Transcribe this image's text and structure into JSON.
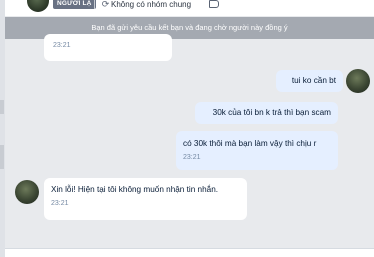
{
  "header": {
    "badge": "NGƯỜI LẠ",
    "group_status": "Không có nhóm chung",
    "group_icon": "refresh-icon",
    "tag_icon": "tag-icon"
  },
  "notice": "Bạn đã gửi yêu cầu kết bạn và đang chờ người này đồng ý",
  "messages": [
    {
      "side": "in",
      "text": "",
      "time": "23:21"
    },
    {
      "side": "out",
      "text": "tui ko cần bt",
      "time": ""
    },
    {
      "side": "out",
      "text": "30k của tôi bn k trả thì bạn scam",
      "time": ""
    },
    {
      "side": "out",
      "text": "có 30k thôi mà bạn làm vậy thì chịu r",
      "time": "23:21"
    },
    {
      "side": "in",
      "text": "Xin lỗi! Hiện tại tôi không muốn nhận tin nhắn.",
      "time": "23:21"
    }
  ],
  "colors": {
    "background": "#e8eaed",
    "incoming_bubble": "#ffffff",
    "outgoing_bubble": "#e5efff",
    "notice_bg": "#a4a9b1",
    "time_text": "#7589a3"
  }
}
